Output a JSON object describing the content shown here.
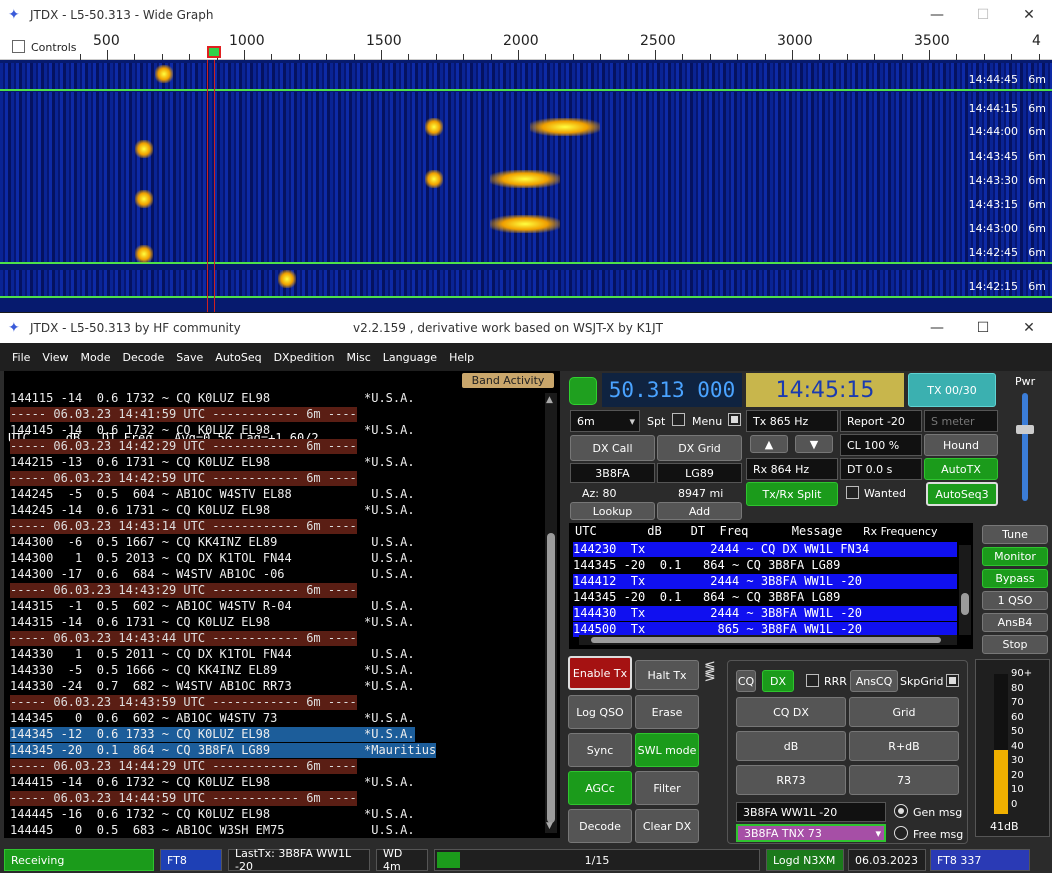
{
  "wide_graph": {
    "title": "JTDX - L5-50.313 - Wide Graph",
    "controls_label": "Controls",
    "scale_ticks": [
      "500",
      "1000",
      "1500",
      "2000",
      "2500",
      "3000",
      "3500",
      "4"
    ],
    "rows": [
      {
        "time": "14:44:45",
        "band": "6m"
      },
      {
        "time": "14:44:15",
        "band": "6m"
      },
      {
        "time": "14:44:00",
        "band": "6m"
      },
      {
        "time": "14:43:45",
        "band": "6m"
      },
      {
        "time": "14:43:30",
        "band": "6m"
      },
      {
        "time": "14:43:15",
        "band": "6m"
      },
      {
        "time": "14:43:00",
        "band": "6m"
      },
      {
        "time": "14:42:45",
        "band": "6m"
      },
      {
        "time": "14:42:15",
        "band": "6m"
      }
    ]
  },
  "main": {
    "title": "JTDX - L5-50.313  by HF community",
    "subtitle": "v2.2.159 , derivative work based on WSJT-X by K1JT",
    "menu": [
      "File",
      "View",
      "Mode",
      "Decode",
      "Save",
      "AutoSeq",
      "DXpedition",
      "Misc",
      "Language",
      "Help"
    ],
    "decode_header": "UTC     dB   DT Freq   Avg=0.56 Lag=+1.60/2",
    "band_activity": "Band Activity",
    "decodes": [
      {
        "text": "144115 -14  0.6 1732 ~ CQ K0LUZ EL98             *U.S.A.",
        "kind": "n"
      },
      {
        "text": "----- 06.03.23 14:41:59 UTC ------------ 6m ----",
        "kind": "s"
      },
      {
        "text": "144145 -14  0.6 1732 ~ CQ K0LUZ EL98             *U.S.A.",
        "kind": "n"
      },
      {
        "text": "----- 06.03.23 14:42:29 UTC ------------ 6m ----",
        "kind": "s"
      },
      {
        "text": "144215 -13  0.6 1731 ~ CQ K0LUZ EL98             *U.S.A.",
        "kind": "n"
      },
      {
        "text": "----- 06.03.23 14:42:59 UTC ------------ 6m ----",
        "kind": "s"
      },
      {
        "text": "144245  -5  0.5  604 ~ AB1OC W4STV EL88           U.S.A.",
        "kind": "n"
      },
      {
        "text": "144245 -14  0.6 1731 ~ CQ K0LUZ EL98             *U.S.A.",
        "kind": "n"
      },
      {
        "text": "----- 06.03.23 14:43:14 UTC ------------ 6m ----",
        "kind": "s"
      },
      {
        "text": "144300  -6  0.5 1667 ~ CQ KK4INZ EL89             U.S.A.",
        "kind": "n"
      },
      {
        "text": "144300   1  0.5 2013 ~ CQ DX K1TOL FN44           U.S.A.",
        "kind": "n"
      },
      {
        "text": "144300 -17  0.6  684 ~ W4STV AB1OC -06            U.S.A.",
        "kind": "n"
      },
      {
        "text": "----- 06.03.23 14:43:29 UTC ------------ 6m ----",
        "kind": "s"
      },
      {
        "text": "144315  -1  0.5  602 ~ AB1OC W4STV R-04           U.S.A.",
        "kind": "n"
      },
      {
        "text": "144315 -14  0.6 1731 ~ CQ K0LUZ EL98             *U.S.A.",
        "kind": "n"
      },
      {
        "text": "----- 06.03.23 14:43:44 UTC ------------ 6m ----",
        "kind": "s"
      },
      {
        "text": "144330   1  0.5 2011 ~ CQ DX K1TOL FN44           U.S.A.",
        "kind": "n"
      },
      {
        "text": "144330  -5  0.5 1666 ~ CQ KK4INZ EL89            *U.S.A.",
        "kind": "n"
      },
      {
        "text": "144330 -24  0.7  682 ~ W4STV AB1OC RR73          *U.S.A.",
        "kind": "n"
      },
      {
        "text": "----- 06.03.23 14:43:59 UTC ------------ 6m ----",
        "kind": "s"
      },
      {
        "text": "144345   0  0.6  602 ~ AB1OC W4STV 73            *U.S.A.",
        "kind": "n"
      },
      {
        "text": "144345 -12  0.6 1733 ~ CQ K0LUZ EL98             *U.S.A.",
        "kind": "h"
      },
      {
        "text": "144345 -20  0.1  864 ~ CQ 3B8FA LG89             *Mauritius",
        "kind": "h"
      },
      {
        "text": "----- 06.03.23 14:44:29 UTC ------------ 6m ----",
        "kind": "s"
      },
      {
        "text": "144415 -14  0.6 1732 ~ CQ K0LUZ EL98             *U.S.A.",
        "kind": "n"
      },
      {
        "text": "----- 06.03.23 14:44:59 UTC ------------ 6m ----",
        "kind": "s"
      },
      {
        "text": "144445 -16  0.6 1732 ~ CQ K0LUZ EL98             *U.S.A.",
        "kind": "n"
      },
      {
        "text": "144445   0  0.5  683 ~ AB1OC W3SH EM75            U.S.A.",
        "kind": "n"
      }
    ],
    "frequency": "50.313 000",
    "clock": "14:45:15",
    "tx_counter": "TX 00/30",
    "pwr_label": "Pwr",
    "band_select": "6m",
    "spt": "Spt",
    "menu_chk": "Menu",
    "tx_freq": "Tx  865  Hz",
    "report": "Report -20",
    "smeter": "S meter",
    "dx_call_btn": "DX Call",
    "dx_grid_btn": "DX Grid",
    "up": "▲",
    "down": "▼",
    "cl": "CL  100 %",
    "hound": "Hound",
    "dx_call": "3B8FA",
    "dx_grid": "LG89",
    "rx_freq": "Rx  864  Hz",
    "dt": "DT  0.0 s",
    "autotx": "AutoTX",
    "az": "Az: 80",
    "dist": "8947 mi",
    "txrx_split": "Tx/Rx Split",
    "wanted": "Wanted",
    "autoseq3": "AutoSeq3",
    "lookup": "Lookup",
    "add": "Add",
    "rx_header": "UTC       dB    DT  Freq      Message",
    "rx_freq_label": "Rx Frequency",
    "rx_lines": [
      {
        "text": "144230  Tx         2444 ~ CQ DX WW1L FN34",
        "tx": true
      },
      {
        "text": "144345 -20  0.1   864 ~ CQ 3B8FA LG89",
        "tx": false
      },
      {
        "text": "144412  Tx         2444 ~ 3B8FA WW1L -20",
        "tx": true
      },
      {
        "text": "144345 -20  0.1   864 ~ CQ 3B8FA LG89",
        "tx": false
      },
      {
        "text": "144430  Tx         2444 ~ 3B8FA WW1L -20",
        "tx": true
      },
      {
        "text": "144500  Tx          865 ~ 3B8FA WW1L -20",
        "tx": true
      }
    ],
    "side_buttons": [
      "Tune",
      "Monitor",
      "Bypass",
      "1 QSO",
      "AnsB4",
      "Stop"
    ],
    "enable_tx": "Enable Tx",
    "halt_tx": "Halt Tx",
    "log_qso": "Log QSO",
    "erase": "Erase",
    "sync": "Sync",
    "swl_mode": "SWL mode",
    "agcc": "AGCc",
    "filter": "Filter",
    "decode": "Decode",
    "clear_dx": "Clear DX",
    "cq": "CQ",
    "dx": "DX",
    "rrr": "RRR",
    "anscq": "AnsCQ",
    "skpgrid": "SkpGrid",
    "macro_btns": [
      "CQ DX",
      "Grid",
      "dB",
      "R+dB",
      "RR73",
      "73"
    ],
    "gen_msg_value": "3B8FA WW1L -20",
    "gen_msg": "Gen msg",
    "free_msg_value": "3B8FA TNX 73",
    "free_msg": "Free msg",
    "meter_scale": [
      "90+",
      "80",
      "70",
      "60",
      "50",
      "40",
      "30",
      "20",
      "10",
      "0"
    ],
    "meter_level_db": 41,
    "meter_reading": "41dB",
    "status": {
      "receiving": "Receiving",
      "mode": "FT8",
      "lasttx": "LastTx: 3B8FA WW1L -20",
      "wd": "WD 4m",
      "progress": "1/15",
      "progress_fraction": 0.07,
      "logd": "Logd N3XM",
      "date": "06.03.2023",
      "mode_count": "FT8  337"
    }
  }
}
